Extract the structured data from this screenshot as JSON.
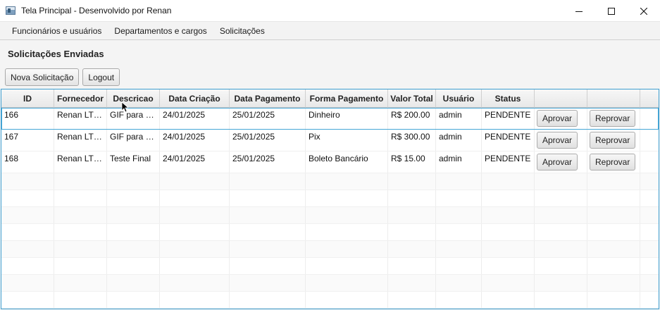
{
  "window": {
    "title": "Tela Principal - Desenvolvido por Renan",
    "app_icon": "window-app-icon"
  },
  "menu": {
    "items": [
      "Funcionários e usuários",
      "Departamentos e cargos",
      "Solicitações"
    ]
  },
  "page": {
    "title": "Solicitações Enviadas"
  },
  "toolbar": {
    "new_label": "Nova Solicitação",
    "logout_label": "Logout"
  },
  "table": {
    "columns": [
      "ID",
      "Fornecedor",
      "Descricao",
      "Data Criação",
      "Data Pagamento",
      "Forma Pagamento",
      "Valor Total",
      "Usuário",
      "Status",
      "",
      ""
    ],
    "rows": [
      {
        "id": "166",
        "fornecedor": "Renan LTDA",
        "descricao": "GIF para a...",
        "data_criacao": "24/01/2025",
        "data_pagamento": "25/01/2025",
        "forma_pagamento": "Dinheiro",
        "valor_total": "R$ 200.00",
        "usuario": "admin",
        "status": "PENDENTE",
        "aprovar": "Aprovar",
        "reprovar": "Reprovar"
      },
      {
        "id": "167",
        "fornecedor": "Renan LTDA",
        "descricao": "GIF para re...",
        "data_criacao": "24/01/2025",
        "data_pagamento": "25/01/2025",
        "forma_pagamento": "Pix",
        "valor_total": "R$ 300.00",
        "usuario": "admin",
        "status": "PENDENTE",
        "aprovar": "Aprovar",
        "reprovar": "Reprovar"
      },
      {
        "id": "168",
        "fornecedor": "Renan LTDA",
        "descricao": "Teste Final",
        "data_criacao": "24/01/2025",
        "data_pagamento": "25/01/2025",
        "forma_pagamento": "Boleto Bancário",
        "valor_total": "R$ 15.00",
        "usuario": "admin",
        "status": "PENDENTE",
        "aprovar": "Aprovar",
        "reprovar": "Reprovar"
      }
    ]
  },
  "colors": {
    "accent": "#3f9fd0",
    "selection_border": "#45a6d6"
  }
}
